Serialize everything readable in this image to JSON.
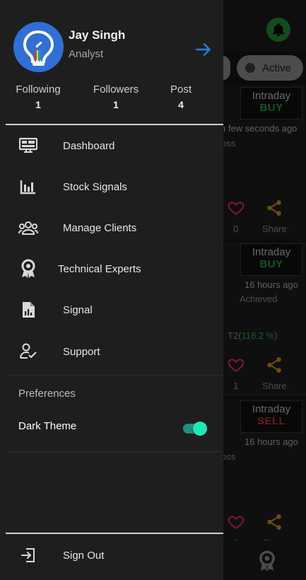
{
  "profile": {
    "name": "Jay Singh",
    "role": "Analyst"
  },
  "stats": [
    {
      "label": "Following",
      "value": "1"
    },
    {
      "label": "Followers",
      "value": "1"
    },
    {
      "label": "Post",
      "value": "4"
    }
  ],
  "menu": [
    {
      "label": "Dashboard",
      "icon": "dashboard-icon"
    },
    {
      "label": "Stock Signals",
      "icon": "bar-chart-icon"
    },
    {
      "label": "Manage Clients",
      "icon": "clients-icon"
    },
    {
      "label": "Technical Experts",
      "icon": "award-icon"
    },
    {
      "label": "Signal",
      "icon": "signal-report-icon"
    },
    {
      "label": "Support",
      "icon": "support-icon"
    }
  ],
  "preferences": {
    "title": "Preferences",
    "dark_theme_label": "Dark Theme",
    "dark_theme_on": true
  },
  "sign_out_label": "Sign Out",
  "background": {
    "filter_active": "Active",
    "cards": [
      {
        "type": "Intraday",
        "action": "BUY",
        "time": "n few seconds ago",
        "status": "oss",
        "likes": "0",
        "share": "Share"
      },
      {
        "type": "Intraday",
        "action": "BUY",
        "time": "16 hours ago",
        "status": "Achieved",
        "target_label": "T2(",
        "target_value": "118.2 %",
        "target_close": ")",
        "likes": "1",
        "share": "Share"
      },
      {
        "type": "Intraday",
        "action": "SELL",
        "time": "16 hours ago",
        "status": "oss",
        "likes": "1",
        "share": "Sh"
      }
    ]
  },
  "colors": {
    "accent_blue": "#2e7bd8",
    "buy_green": "#1f9e3d",
    "sell_red": "#c0302a",
    "toggle_teal": "#1de9b6",
    "share_orange": "#c98a1d",
    "heart_pink": "#d8315b"
  }
}
